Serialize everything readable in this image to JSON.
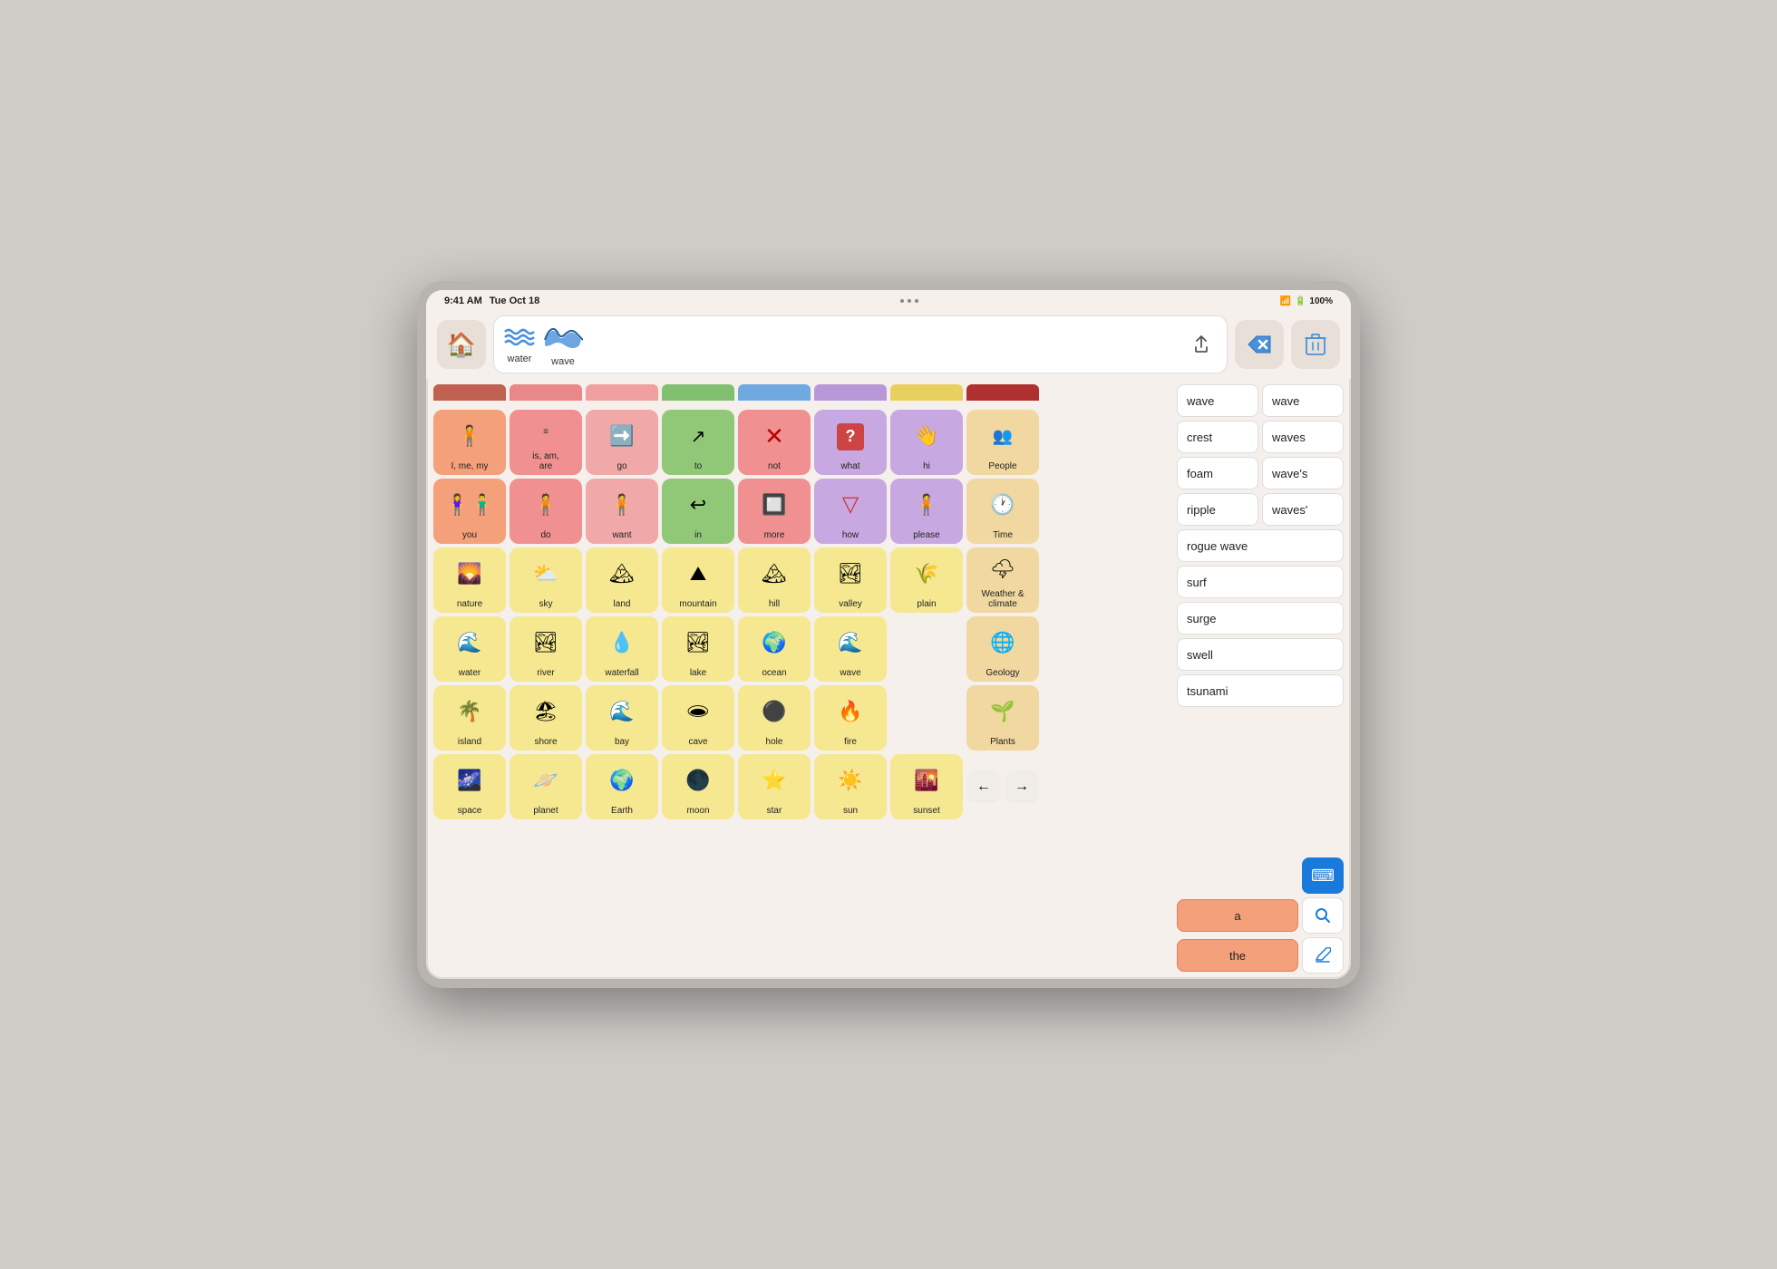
{
  "statusBar": {
    "time": "9:41 AM",
    "date": "Tue Oct 18",
    "battery": "100%",
    "wifi": "WiFi"
  },
  "sentenceBar": {
    "words": [
      {
        "label": "water",
        "icon": "🌊"
      },
      {
        "label": "wave",
        "icon": "🌊"
      }
    ]
  },
  "buttons": {
    "home": "🏠",
    "backspace": "⌫",
    "delete": "🗑",
    "share": "⬆"
  },
  "scrollTabs": {
    "colors": [
      "#f4a07a",
      "#f09090",
      "#f5b8b8",
      "#90c878",
      "#88b8e8",
      "#c8a8e0",
      "#f5e090",
      "#c04040"
    ]
  },
  "gridRows": [
    {
      "cells": [
        {
          "label": "I, me, my",
          "icon": "🧍",
          "color": "salmon"
        },
        {
          "label": "is, am,\nare",
          "icon": "➖",
          "color": "pink"
        },
        {
          "label": "go",
          "icon": "➡️",
          "color": "light-pink"
        },
        {
          "label": "to",
          "icon": "↗️",
          "color": "green"
        },
        {
          "label": "not",
          "icon": "❌",
          "color": "pink"
        },
        {
          "label": "what",
          "icon": "❓",
          "color": "purple"
        },
        {
          "label": "hi",
          "icon": "👋",
          "color": "purple"
        },
        {
          "label": "People",
          "icon": "👥",
          "color": "tan"
        }
      ]
    },
    {
      "cells": [
        {
          "label": "you",
          "icon": "🧍‍♂️",
          "color": "salmon"
        },
        {
          "label": "do",
          "icon": "🧍",
          "color": "pink"
        },
        {
          "label": "want",
          "icon": "🧍",
          "color": "light-pink"
        },
        {
          "label": "in",
          "icon": "↩️",
          "color": "green"
        },
        {
          "label": "more",
          "icon": "🔲",
          "color": "pink"
        },
        {
          "label": "how",
          "icon": "🔻",
          "color": "purple"
        },
        {
          "label": "please",
          "icon": "🧍",
          "color": "purple"
        },
        {
          "label": "Time",
          "icon": "🕐",
          "color": "tan"
        }
      ]
    },
    {
      "cells": [
        {
          "label": "nature",
          "icon": "🌄",
          "color": "yellow"
        },
        {
          "label": "sky",
          "icon": "⛅",
          "color": "yellow"
        },
        {
          "label": "land",
          "icon": "🏔",
          "color": "yellow"
        },
        {
          "label": "mountain",
          "icon": "⛰",
          "color": "yellow"
        },
        {
          "label": "hill",
          "icon": "🏔",
          "color": "yellow"
        },
        {
          "label": "valley",
          "icon": "🏞",
          "color": "yellow"
        },
        {
          "label": "plain",
          "icon": "🌾",
          "color": "yellow"
        },
        {
          "label": "Weather &\nclimate",
          "icon": "🌩",
          "color": "tan"
        }
      ]
    },
    {
      "cells": [
        {
          "label": "water",
          "icon": "🌊",
          "color": "yellow"
        },
        {
          "label": "river",
          "icon": "🏞",
          "color": "yellow"
        },
        {
          "label": "waterfall",
          "icon": "💧",
          "color": "yellow"
        },
        {
          "label": "lake",
          "icon": "🏞",
          "color": "yellow"
        },
        {
          "label": "ocean",
          "icon": "🌍",
          "color": "yellow"
        },
        {
          "label": "wave",
          "icon": "🌊",
          "color": "yellow"
        },
        {
          "label": "",
          "icon": "",
          "color": "empty"
        },
        {
          "label": "Geology",
          "icon": "🌐",
          "color": "tan"
        }
      ]
    },
    {
      "cells": [
        {
          "label": "island",
          "icon": "🌴",
          "color": "yellow"
        },
        {
          "label": "shore",
          "icon": "🏖",
          "color": "yellow"
        },
        {
          "label": "bay",
          "icon": "🌊",
          "color": "yellow"
        },
        {
          "label": "cave",
          "icon": "🕳",
          "color": "yellow"
        },
        {
          "label": "hole",
          "icon": "🕳",
          "color": "yellow"
        },
        {
          "label": "fire",
          "icon": "🔥",
          "color": "yellow"
        },
        {
          "label": "",
          "icon": "",
          "color": "empty"
        },
        {
          "label": "Plants",
          "icon": "🌱",
          "color": "tan"
        }
      ]
    },
    {
      "cells": [
        {
          "label": "space",
          "icon": "🌌",
          "color": "yellow"
        },
        {
          "label": "planet",
          "icon": "🪐",
          "color": "yellow"
        },
        {
          "label": "Earth",
          "icon": "🌍",
          "color": "yellow"
        },
        {
          "label": "moon",
          "icon": "🌑",
          "color": "yellow"
        },
        {
          "label": "star",
          "icon": "⭐",
          "color": "yellow"
        },
        {
          "label": "sun",
          "icon": "☀️",
          "color": "yellow"
        },
        {
          "label": "sunset",
          "icon": "🌇",
          "color": "yellow"
        },
        {
          "label": "",
          "icon": "",
          "color": "empty"
        }
      ]
    }
  ],
  "sidebarWords": [
    {
      "label": "wave",
      "variant": "base"
    },
    {
      "label": "wave",
      "variant": "base2"
    },
    {
      "label": "crest",
      "variant": "base"
    },
    {
      "label": "waves",
      "variant": "base"
    },
    {
      "label": "foam",
      "variant": "base"
    },
    {
      "label": "wave's",
      "variant": "base"
    },
    {
      "label": "ripple",
      "variant": "base"
    },
    {
      "label": "waves'",
      "variant": "base"
    },
    {
      "label": "rogue wave",
      "variant": "base"
    },
    {
      "label": "surf",
      "variant": "base"
    },
    {
      "label": "surge",
      "variant": "base"
    },
    {
      "label": "swell",
      "variant": "base"
    },
    {
      "label": "tsunami",
      "variant": "base"
    }
  ],
  "sidebarBottom": {
    "letter_a": "a",
    "letter_the": "the",
    "keyboard_icon": "⌨",
    "search_icon": "🔍",
    "edit_icon": "✏️"
  }
}
